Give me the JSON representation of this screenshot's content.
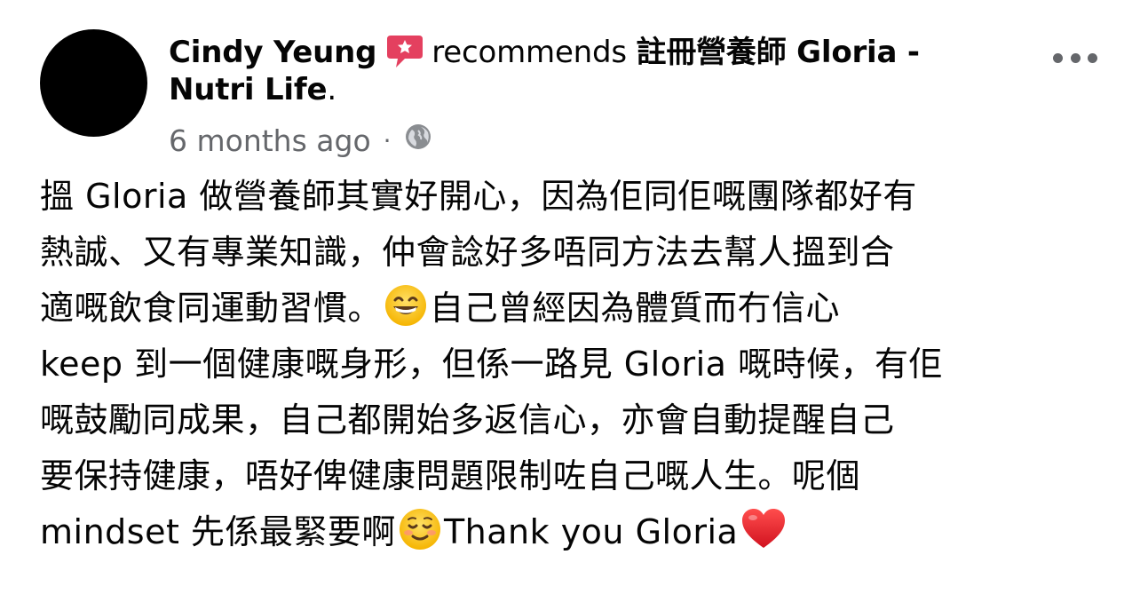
{
  "post": {
    "author": "Cindy Yeung",
    "action": "recommends",
    "page_name_part1": "註冊營養師 Gloria -",
    "page_name_part2": "Nutri Life",
    "period": ".",
    "timestamp": "6 months ago",
    "separator": "·",
    "privacy_icon": "globe-icon",
    "recommend_icon": "recommend-badge-icon",
    "more_icon": "more-options-icon",
    "body_lines": [
      "搵 Gloria 做營養師其實好開心，因為佢同佢嘅團隊都好有",
      "熱誠、又有專業知識，仲會諗好多唔同方法去幫人搵到合",
      "適嘅飲食同運動習慣。",
      "自己曾經因為體質而冇信心",
      "keep 到一個健康嘅身形，但係一路見 Gloria 嘅時候，有佢",
      "嘅鼓勵同成果，自己都開始多返信心，亦會自動提醒自己",
      "要保持健康，唔好俾健康問題限制咗自己嘅人生。呢個",
      "mindset 先係最緊要啊",
      "Thank you Gloria"
    ],
    "emojis": [
      "grinning-face-emoji",
      "smiling-face-emoji",
      "red-heart-emoji"
    ]
  },
  "colors": {
    "text": "#050505",
    "secondary": "#65676b",
    "recommend_accent": "#e4405f",
    "heart": "#e0245e"
  }
}
